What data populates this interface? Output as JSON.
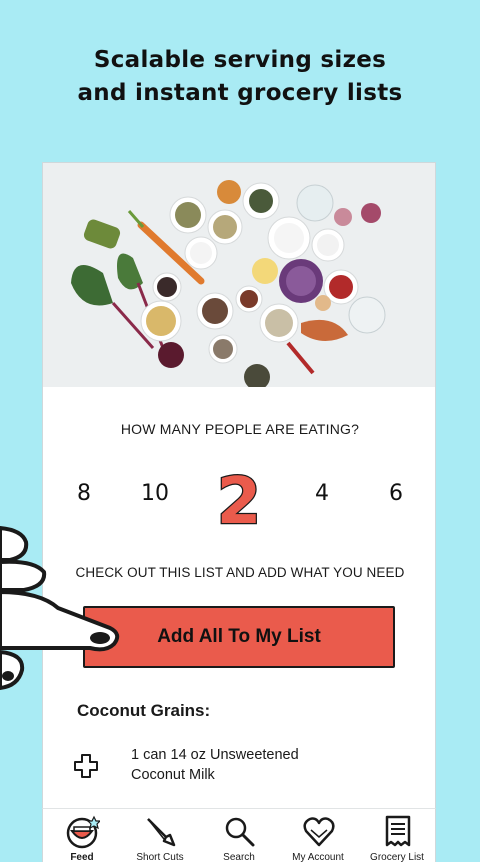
{
  "headline": {
    "line1": "Scalable serving sizes",
    "line2": "and instant grocery lists"
  },
  "servings": {
    "question": "HOW MANY PEOPLE ARE EATING?",
    "options": [
      "8",
      "10",
      "2",
      "4",
      "6"
    ],
    "selected": "2"
  },
  "list": {
    "instruction": "CHECK OUT THIS LIST AND ADD WHAT YOU NEED",
    "add_all_label": "Add All To My List",
    "section_title": "Coconut Grains:",
    "ingredients": [
      {
        "line1": "1 can 14 oz Unsweetened",
        "line2": "Coconut Milk",
        "icon": "plus-icon"
      }
    ]
  },
  "tabbar": {
    "items": [
      {
        "label": "Feed",
        "icon": "feed-mouth-icon",
        "active": true
      },
      {
        "label": "Short Cuts",
        "icon": "knife-icon"
      },
      {
        "label": "Search",
        "icon": "search-icon"
      },
      {
        "label": "My Account",
        "icon": "heart-icon"
      },
      {
        "label": "Grocery List",
        "icon": "receipt-icon"
      }
    ]
  },
  "colors": {
    "background": "#a9ebf4",
    "accent": "#ea5b4c",
    "text": "#1a1a1a"
  }
}
